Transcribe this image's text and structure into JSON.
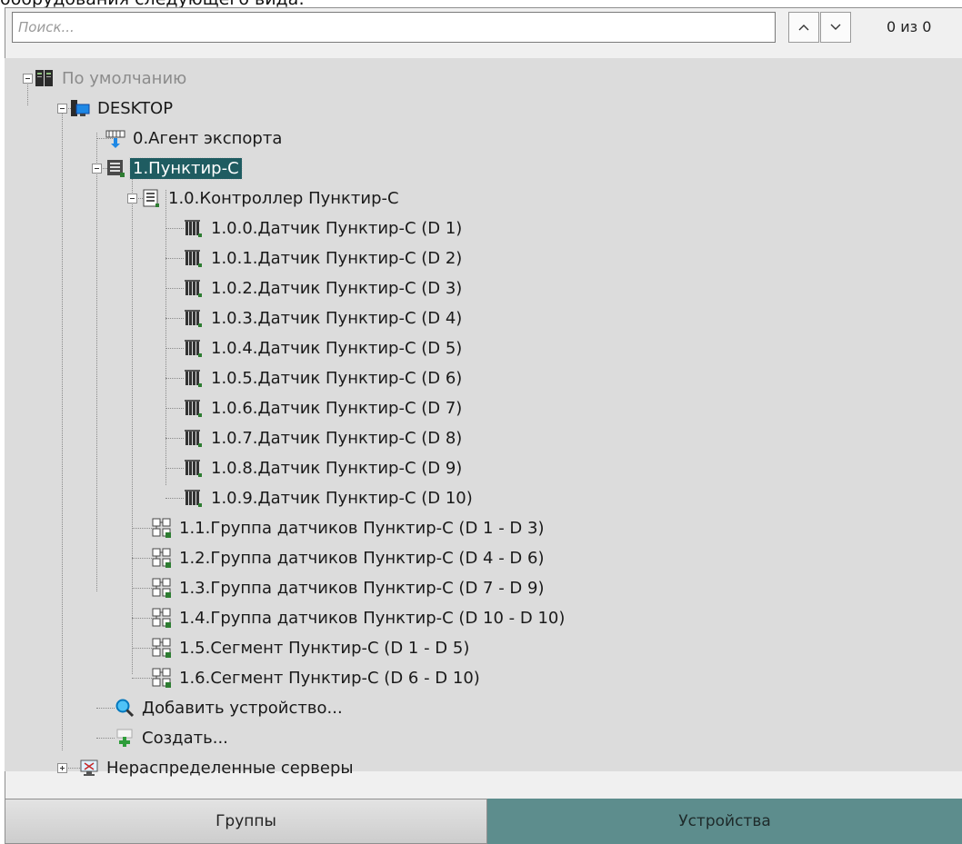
{
  "caption": "оборудования следующего вида:",
  "search": {
    "placeholder": "Поиск...",
    "counter": "0 из 0"
  },
  "nav": {
    "up_icon": "chevron-up-icon",
    "down_icon": "chevron-down-icon"
  },
  "tree": {
    "root": "По умолчанию",
    "server": "DESKTOP",
    "export_agent": "0.Агент экспорта",
    "device": "1.Пунктир-С",
    "controller": "1.0.Контроллер Пунктир-С",
    "sensors": [
      "1.0.0.Датчик Пунктир-С (D 1)",
      "1.0.1.Датчик Пунктир-С (D 2)",
      "1.0.2.Датчик Пунктир-С (D 3)",
      "1.0.3.Датчик Пунктир-С (D 4)",
      "1.0.4.Датчик Пунктир-С (D 5)",
      "1.0.5.Датчик Пунктир-С (D 6)",
      "1.0.6.Датчик Пунктир-С (D 7)",
      "1.0.7.Датчик Пунктир-С (D 8)",
      "1.0.8.Датчик Пунктир-С (D 9)",
      "1.0.9.Датчик Пунктир-С (D 10)"
    ],
    "groups": [
      "1.1.Группа датчиков Пунктир-С (D 1 - D 3)",
      "1.2.Группа датчиков Пунктир-С (D 4 - D 6)",
      "1.3.Группа датчиков Пунктир-С (D 7 - D 9)",
      "1.4.Группа датчиков Пунктир-С (D 10 - D 10)",
      "1.5.Сегмент Пунктир-С (D 1 - D 5)",
      "1.6.Сегмент Пунктир-С (D 6 - D 10)"
    ],
    "add_device": "Добавить устройство...",
    "create": "Создать...",
    "unassigned": "Нераспределенные серверы"
  },
  "tabs": {
    "groups": "Группы",
    "devices": "Устройства"
  },
  "colors": {
    "selection": "#1f5c61",
    "active_tab": "#5d8d8d",
    "tree_bg": "#dcdcdc"
  }
}
